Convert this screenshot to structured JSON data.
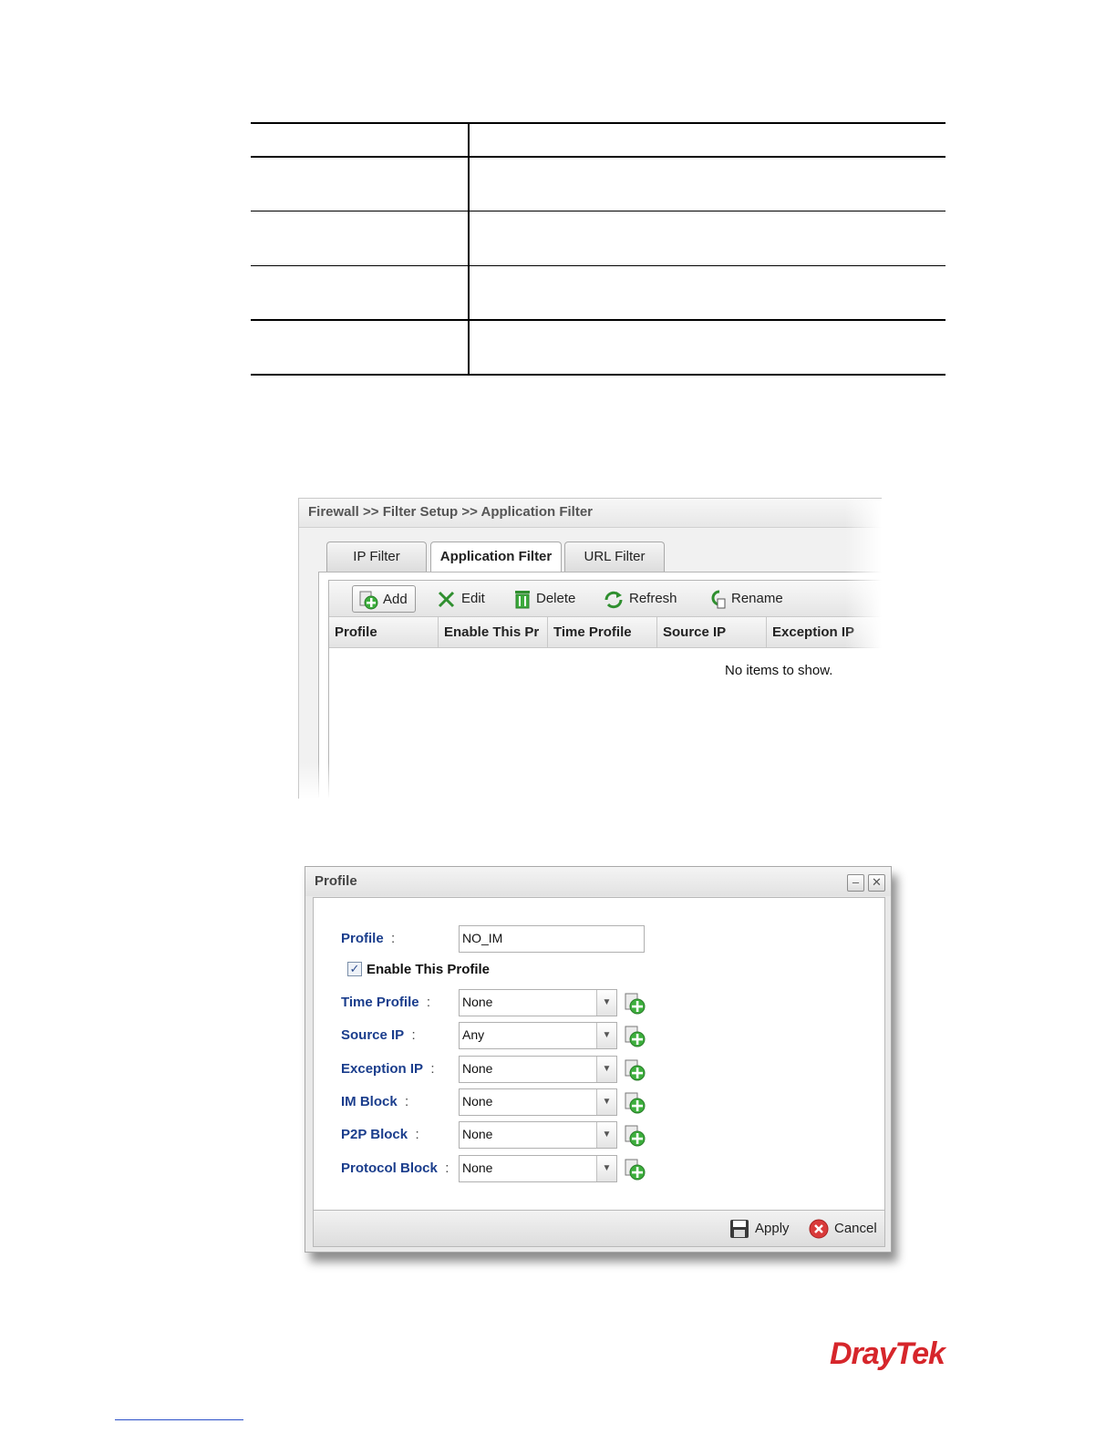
{
  "app": {
    "breadcrumb": "Firewall >> Filter Setup >> Application Filter",
    "tabs": [
      "IP Filter",
      "Application Filter",
      "URL Filter"
    ],
    "active_tab": "Application Filter",
    "toolbar": {
      "add": "Add",
      "edit": "Edit",
      "delete": "Delete",
      "refresh": "Refresh",
      "rename": "Rename"
    },
    "columns": [
      "Profile",
      "Enable This Pr",
      "Time Profile",
      "Source IP",
      "Exception IP"
    ],
    "empty_message": "No items to show."
  },
  "dialog": {
    "title": "Profile",
    "profile_label": "Profile",
    "profile_value": "NO_IM",
    "enable_label": "Enable This Profile",
    "enable_checked": true,
    "fields": [
      {
        "label": "Time Profile",
        "value": "None"
      },
      {
        "label": "Source IP",
        "value": "Any"
      },
      {
        "label": "Exception IP",
        "value": "None"
      },
      {
        "label": "IM Block",
        "value": "None"
      },
      {
        "label": "P2P Block",
        "value": "None"
      },
      {
        "label": "Protocol Block",
        "value": "None"
      }
    ],
    "apply": "Apply",
    "cancel": "Cancel"
  },
  "brand": {
    "logo": "DrayTek",
    "color": "#d6262b",
    "label_color": "#1a3d8c"
  }
}
